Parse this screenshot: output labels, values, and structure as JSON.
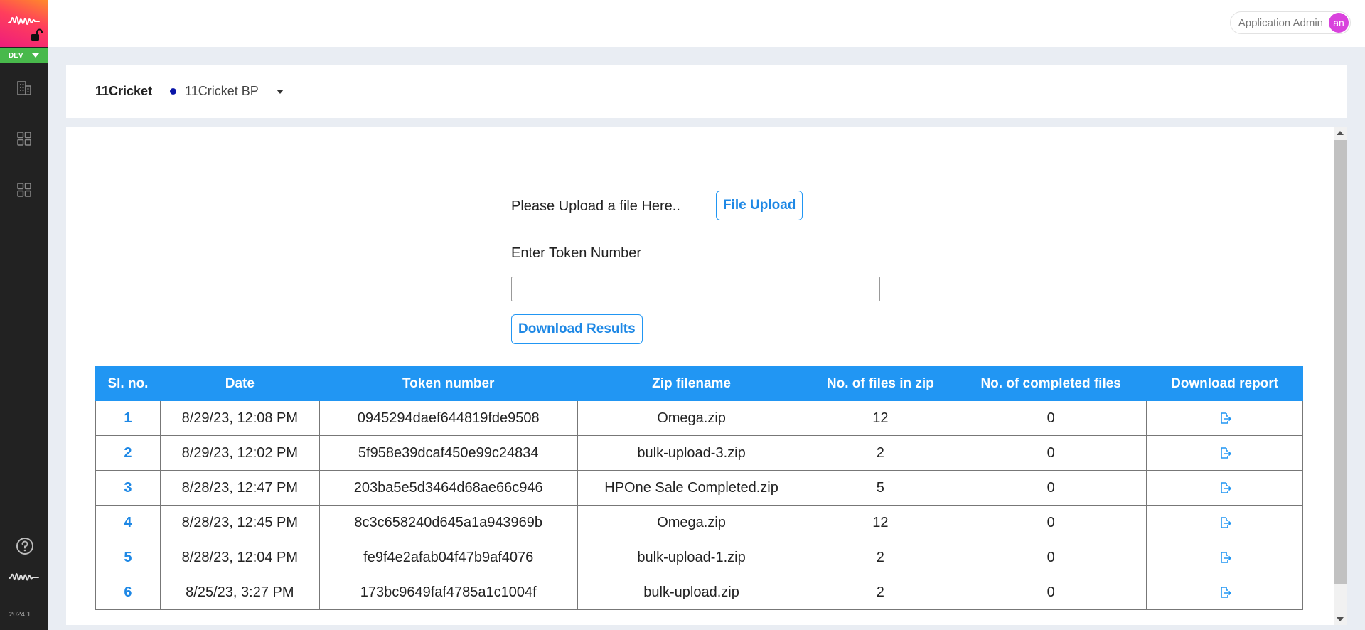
{
  "app": {
    "env": "DEV",
    "version": "2024.1"
  },
  "header": {
    "user_name": "Application Admin",
    "avatar_initials": "an"
  },
  "org": {
    "name": "11Cricket",
    "unit": "11Cricket BP",
    "unit_dot_color": "#0a16a8"
  },
  "upload": {
    "label": "Please Upload a file Here..",
    "button": "File Upload",
    "token_label": "Enter Token Number",
    "token_value": "",
    "download_button": "Download Results"
  },
  "table": {
    "headers": [
      "Sl. no.",
      "Date",
      "Token number",
      "Zip filename",
      "No. of files in zip",
      "No. of completed files",
      "Download report"
    ],
    "rows": [
      {
        "sl": "1",
        "date": "8/29/23, 12:08 PM",
        "token": "0945294daef644819fde9508",
        "zip": "Omega.zip",
        "files": "12",
        "completed": "0"
      },
      {
        "sl": "2",
        "date": "8/29/23, 12:02 PM",
        "token": "5f958e39dcaf450e99c24834",
        "zip": "bulk-upload-3.zip",
        "files": "2",
        "completed": "0"
      },
      {
        "sl": "3",
        "date": "8/28/23, 12:47 PM",
        "token": "203ba5e5d3464d68ae66c946",
        "zip": "HPOne Sale Completed.zip",
        "files": "5",
        "completed": "0"
      },
      {
        "sl": "4",
        "date": "8/28/23, 12:45 PM",
        "token": "8c3c658240d645a1a943969b",
        "zip": "Omega.zip",
        "files": "12",
        "completed": "0"
      },
      {
        "sl": "5",
        "date": "8/28/23, 12:04 PM",
        "token": "fe9f4e2afab04f47b9af4076",
        "zip": "bulk-upload-1.zip",
        "files": "2",
        "completed": "0"
      },
      {
        "sl": "6",
        "date": "8/25/23, 3:27 PM",
        "token": "173bc9649faf4785a1c1004f",
        "zip": "bulk-upload.zip",
        "files": "2",
        "completed": "0"
      }
    ]
  },
  "icons": {
    "brand": "waveform-logo-icon",
    "lock": "unlocked-icon",
    "nav": [
      "building-icon",
      "grid-icon",
      "grid-icon"
    ],
    "help": "help-circle-icon",
    "download_report": "export-file-icon"
  },
  "colors": {
    "accent": "#2196f3",
    "sidebar": "#222222",
    "env_badge": "#48b94b",
    "avatar": "#d942dd"
  }
}
